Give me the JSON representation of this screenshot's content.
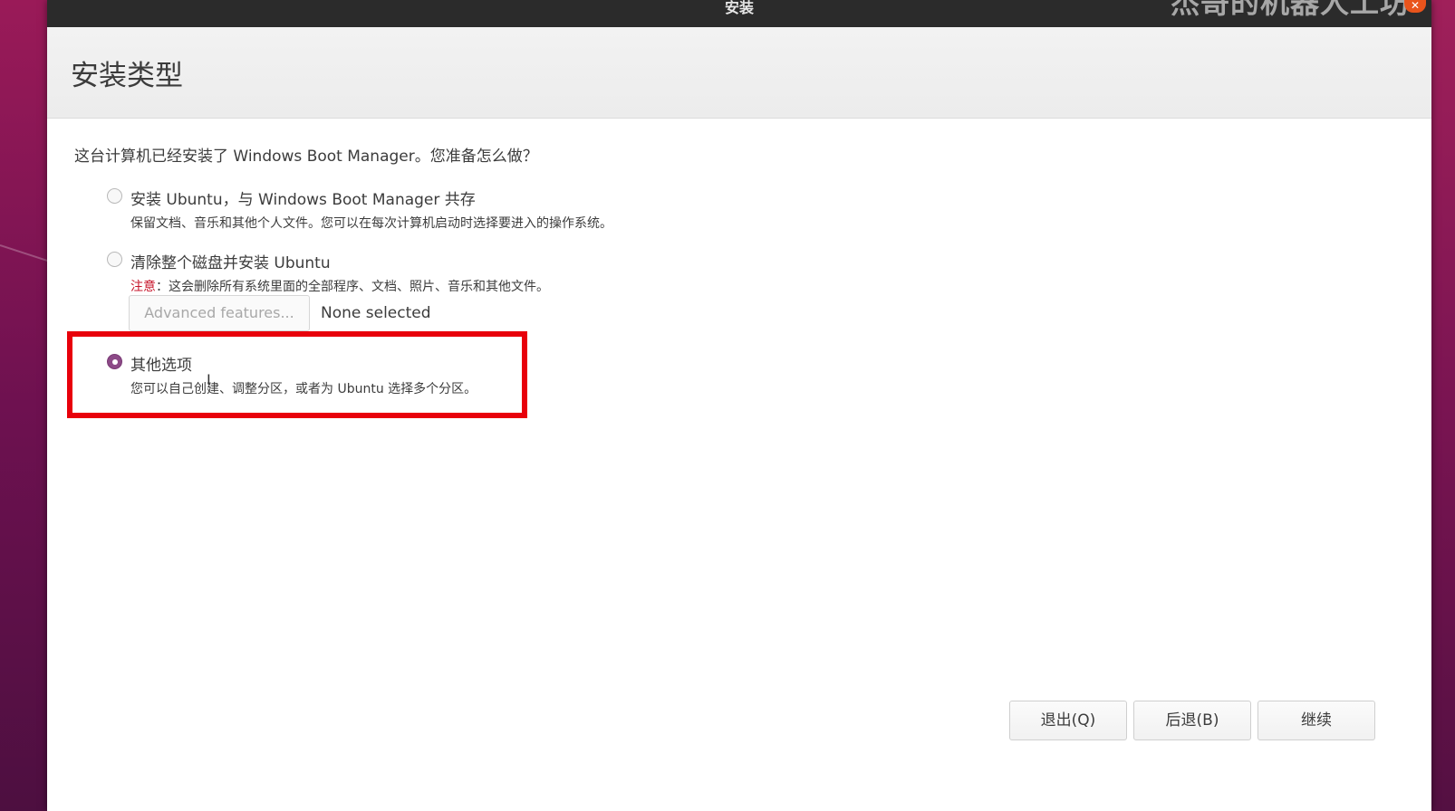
{
  "window": {
    "title": "安装",
    "watermark": "杰哥的机器人工坊",
    "close_glyph": "✕"
  },
  "header": {
    "title": "安装类型"
  },
  "main": {
    "question": "这台计算机已经安装了 Windows Boot Manager。您准备怎么做？",
    "options": [
      {
        "label": "安装 Ubuntu，与 Windows Boot Manager 共存",
        "description": "保留文档、音乐和其他个人文件。您可以在每次计算机启动时选择要进入的操作系统。",
        "selected": false
      },
      {
        "label": "清除整个磁盘并安装 Ubuntu",
        "warning_prefix": "注意",
        "description": "：这会删除所有系统里面的全部程序、文档、照片、音乐和其他文件。",
        "selected": false
      },
      {
        "label": "其他选项",
        "description": "您可以自己创建、调整分区，或者为 Ubuntu 选择多个分区。",
        "selected": true
      }
    ],
    "advanced_button_label": "Advanced features...",
    "advanced_status": "None selected"
  },
  "footer": {
    "quit_label": "退出(Q)",
    "back_label": "后退(B)",
    "continue_label": "继续"
  },
  "colors": {
    "highlight": "#e8000b",
    "radio_selected": "#8c4a87",
    "warning": "#c7162b"
  }
}
